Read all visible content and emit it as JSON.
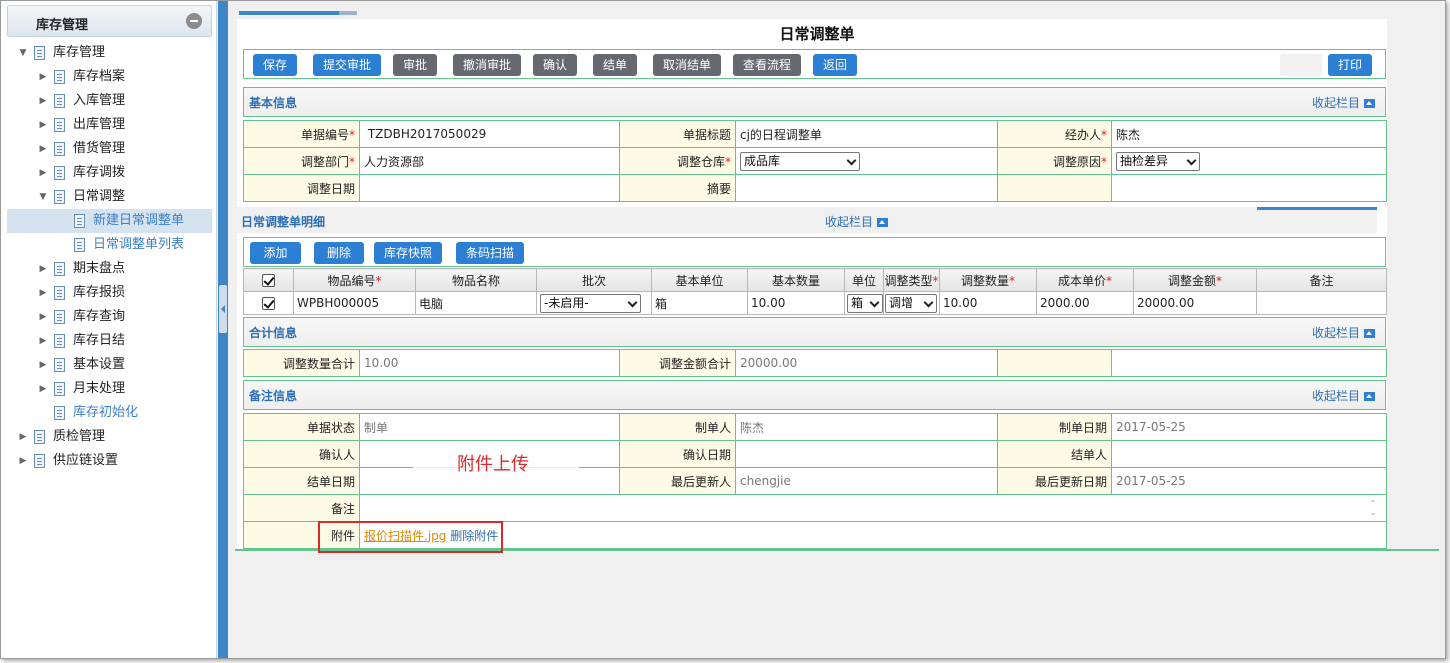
{
  "sidebar": {
    "title": "库存管理",
    "tree": [
      {
        "label": "库存管理",
        "level": 0,
        "expanded": true
      },
      {
        "label": "库存档案",
        "level": 1
      },
      {
        "label": "入库管理",
        "level": 1
      },
      {
        "label": "出库管理",
        "level": 1
      },
      {
        "label": "借货管理",
        "level": 1
      },
      {
        "label": "库存调拨",
        "level": 1
      },
      {
        "label": "日常调整",
        "level": 1,
        "expanded": true
      },
      {
        "label": "新建日常调整单",
        "level": 2,
        "selected": true
      },
      {
        "label": "日常调整单列表",
        "level": 2
      },
      {
        "label": "期末盘点",
        "level": 1
      },
      {
        "label": "库存报损",
        "level": 1
      },
      {
        "label": "库存查询",
        "level": 1
      },
      {
        "label": "库存日结",
        "level": 1
      },
      {
        "label": "基本设置",
        "level": 1
      },
      {
        "label": "月末处理",
        "level": 1
      },
      {
        "label": "库存初始化",
        "level": 1
      },
      {
        "label": "质检管理",
        "level": 0
      },
      {
        "label": "供应链设置",
        "level": 0
      }
    ]
  },
  "page": {
    "title": "日常调整单"
  },
  "toolbar": {
    "save": "保存",
    "submit_approval": "提交审批",
    "approve": "审批",
    "cancel_approval": "撤消审批",
    "confirm": "确认",
    "close": "结单",
    "cancel_close": "取消结单",
    "view_flow": "查看流程",
    "back": "返回",
    "print": "打印"
  },
  "basic": {
    "header": "基本信息",
    "collapse": "收起栏目",
    "doc_no_label": "单据编号",
    "doc_no": "TZDBH2017050029",
    "doc_title_label": "单据标题",
    "doc_title": "cj的日程调整单",
    "handler_label": "经办人",
    "handler": "陈杰",
    "dept_label": "调整部门",
    "dept": "人力资源部",
    "warehouse_label": "调整仓库",
    "warehouse": "成品库",
    "reason_label": "调整原因",
    "reason": "抽检差异",
    "date_label": "调整日期",
    "date": "",
    "summary_label": "摘要",
    "summary": ""
  },
  "detail": {
    "header": "日常调整单明细",
    "collapse": "收起栏目",
    "add": "添加",
    "delete": "删除",
    "snapshot": "库存快照",
    "barcode": "条码扫描",
    "columns": [
      "物品编号",
      "物品名称",
      "批次",
      "基本单位",
      "基本数量",
      "单位",
      "调整类型",
      "调整数量",
      "成本单价",
      "调整金额",
      "备注"
    ],
    "rows": [
      {
        "code": "WPBH000005",
        "name": "电脑",
        "batch": "-未启用-",
        "base_unit": "箱",
        "base_qty": "10.00",
        "unit": "箱",
        "adj_type": "调增",
        "adj_qty": "10.00",
        "unit_cost": "2000.00",
        "amount": "20000.00",
        "remark": ""
      }
    ]
  },
  "totals": {
    "header": "合计信息",
    "collapse": "收起栏目",
    "qty_label": "调整数量合计",
    "qty": "10.00",
    "amount_label": "调整金额合计",
    "amount": "20000.00"
  },
  "notes": {
    "header": "备注信息",
    "collapse": "收起栏目",
    "status_label": "单据状态",
    "status": "制单",
    "creator_label": "制单人",
    "creator": "陈杰",
    "created_label": "制单日期",
    "created": "2017-05-25",
    "confirmer_label": "确认人",
    "confirmer": "",
    "confirm_date_label": "确认日期",
    "confirm_date": "",
    "closer_label": "结单人",
    "closer": "",
    "close_date_label": "结单日期",
    "close_date": "",
    "updater_label": "最后更新人",
    "updater": "chengjie",
    "updated_label": "最后更新日期",
    "updated": "2017-05-25",
    "remark_label": "备注",
    "remark": "",
    "attach_label": "附件",
    "attach_file": "报价扫描件.jpg",
    "attach_delete": "删除附件"
  },
  "annotation": {
    "text": "附件上传"
  }
}
